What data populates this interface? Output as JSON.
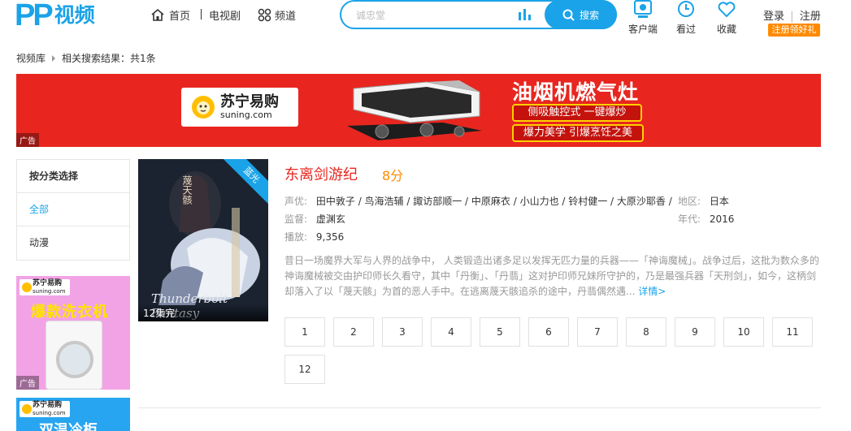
{
  "header": {
    "logo_mark": "PP",
    "logo_text": "视频",
    "nav": [
      {
        "label": "首页"
      },
      {
        "label": "电视剧"
      },
      {
        "label": "频道"
      }
    ],
    "search": {
      "placeholder": "诚忠堂",
      "button_label": "搜索"
    },
    "quick_links": [
      {
        "label": "客户端"
      },
      {
        "label": "看过"
      },
      {
        "label": "收藏"
      }
    ],
    "login_label": "登录",
    "register_label": "注册",
    "promo_badge": "注册领好礼"
  },
  "breadcrumb": {
    "root": "视频库",
    "current": "相关搜索结果：共1条"
  },
  "banner_ad": {
    "brand_cn": "苏宁易购",
    "brand_en": "suning.com",
    "headline": "油烟机燃气灶",
    "line1": "侧吸触控式  一键爆炒",
    "line2": "爆力美学 引爆烹饪之美",
    "tag": "广告"
  },
  "filter": {
    "heading": "按分类选择",
    "items": [
      {
        "label": "全部",
        "active": true
      },
      {
        "label": "动漫",
        "active": false
      }
    ]
  },
  "side_ads": [
    {
      "brand_cn": "苏宁易购",
      "brand_en": "suning.com",
      "title": "爆款洗衣机",
      "tag": "广告"
    },
    {
      "brand_cn": "苏宁易购",
      "brand_en": "suning.com",
      "title": "双温冷柜"
    }
  ],
  "result": {
    "poster_ribbon": "蓝光",
    "poster_english_title": "Thunderbolt Fantasy",
    "poster_episodes": "12集完",
    "title": "东离剑游纪",
    "score": "8分",
    "cast_label": "声优:",
    "cast": "田中敦子 / 鸟海浩辅 / 諏访部顺一 / 中原麻衣 / 小山力也 / 铃村健一 / 大原沙耶香 /",
    "director_label": "监督:",
    "director": "虚渊玄",
    "plays_label": "播放:",
    "plays": "9,356",
    "region_label": "地区:",
    "region": "日本",
    "year_label": "年代:",
    "year": "2016",
    "description": "昔日一场魔界大军与人界的战争中， 人类锻造出诸多足以发挥无匹力量的兵器——「神诲魔械」。战争过后，这批为数众多的神诲魔械被交由护印师长久看守，其中「丹衡」、「丹翡」这对护印师兄妹所守护的，乃是最强兵器「天刑剑」，如今，这柄剑却落入了以「蔑天骸」为首的恶人手中。在逃离蔑天骸追杀的途中，丹翡偶然遇...",
    "more_label": "详情>",
    "episodes": [
      "1",
      "2",
      "3",
      "4",
      "5",
      "6",
      "7",
      "8",
      "9",
      "10",
      "11",
      "12"
    ]
  },
  "colors": {
    "brand_blue": "#1aa3e8",
    "title_red": "#e8261f",
    "score_orange": "#ff8a00",
    "banner_red": "#e8261f"
  }
}
